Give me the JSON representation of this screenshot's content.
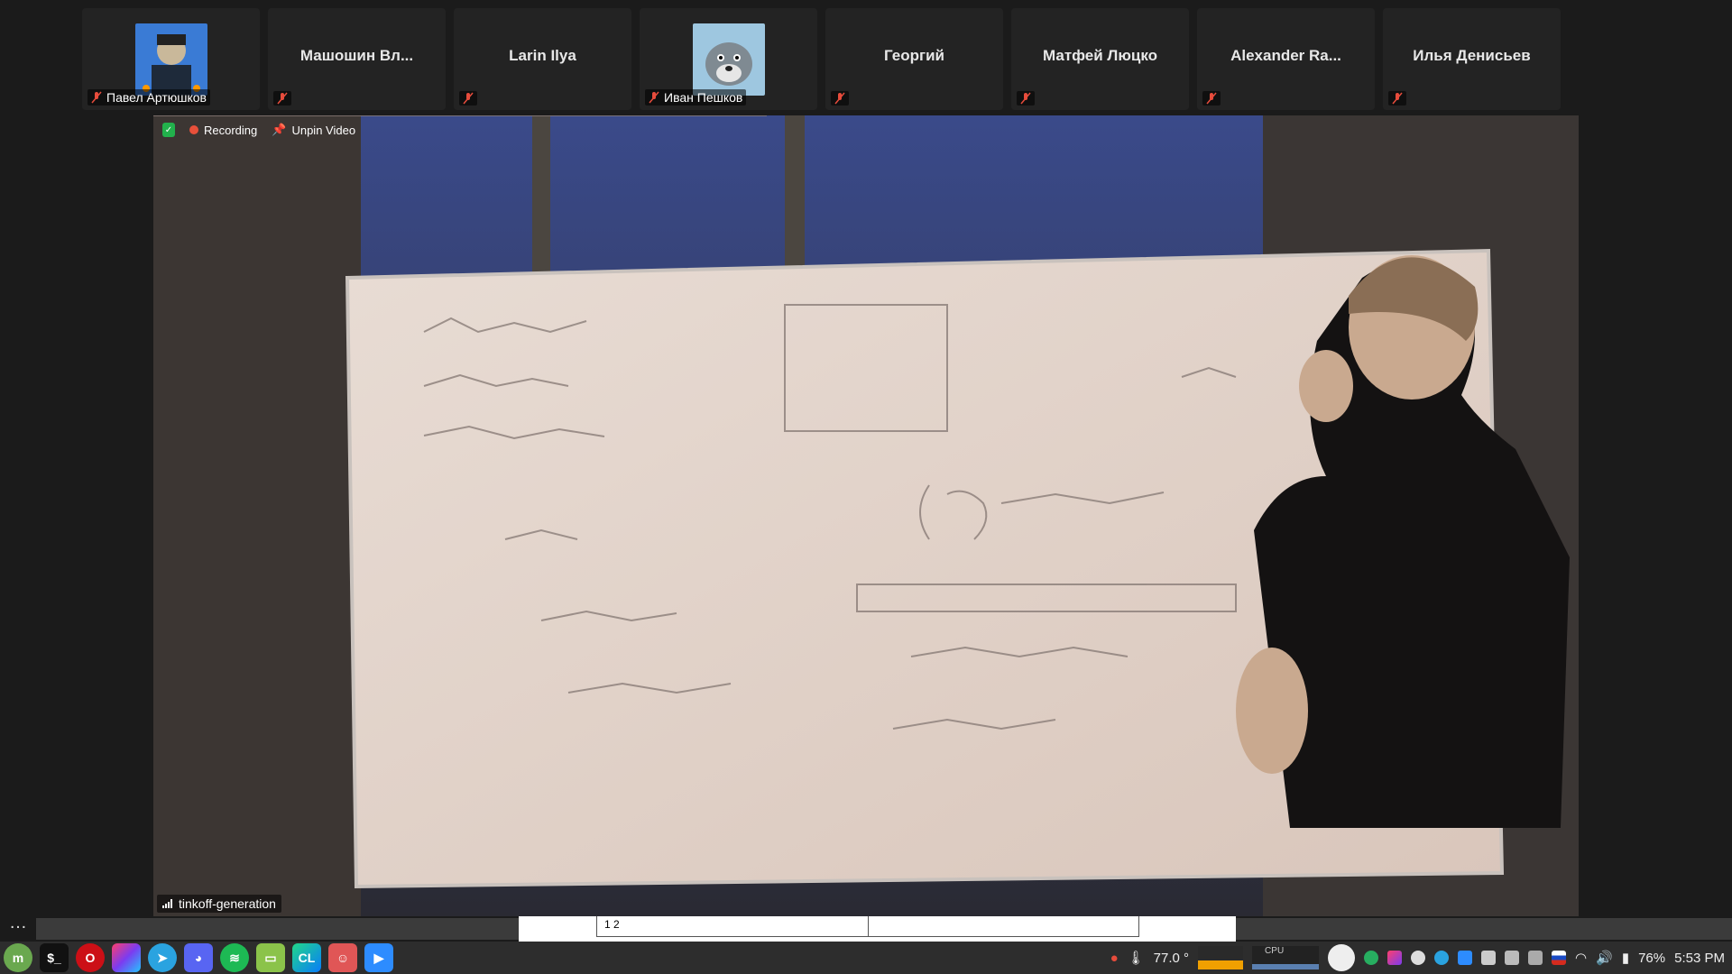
{
  "participants": [
    {
      "name": "",
      "label": "Павел Артюшков",
      "has_avatar": true
    },
    {
      "name": "Машошин Вл...",
      "label": "",
      "has_avatar": false
    },
    {
      "name": "Larin Ilya",
      "label": "",
      "has_avatar": false
    },
    {
      "name": "",
      "label": "Иван Пешков",
      "has_avatar": true
    },
    {
      "name": "Георгий",
      "label": "",
      "has_avatar": false
    },
    {
      "name": "Матфей Люцко",
      "label": "",
      "has_avatar": false
    },
    {
      "name": "Alexander Ra...",
      "label": "",
      "has_avatar": false
    },
    {
      "name": "Илья Денисьев",
      "label": "",
      "has_avatar": false
    }
  ],
  "video": {
    "recording_label": "Recording",
    "unpin_label": "Unpin Video",
    "meeting_name": "tinkoff-generation"
  },
  "pager": {
    "cells": [
      "1 2",
      ""
    ]
  },
  "taskbar": {
    "apps": [
      "mint-menu-icon",
      "terminal-icon",
      "opera-icon",
      "jetbrains-toolbox-icon",
      "telegram-icon",
      "discord-icon",
      "spotify-icon",
      "files-icon",
      "clion-icon",
      "retroarch-icon",
      "zoom-icon"
    ],
    "temperature": "77.0 °",
    "cpu_label": "CPU",
    "battery": "76%",
    "time": "5:53 PM"
  },
  "colors": {
    "recording": "#e8503a",
    "shield": "#22b14c",
    "taskbar": "#2d2d2d"
  }
}
